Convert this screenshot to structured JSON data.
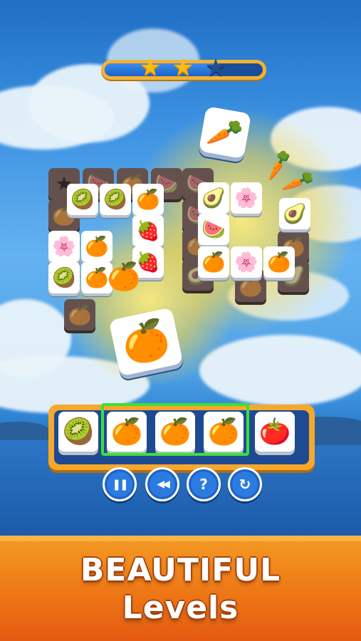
{
  "progress": {
    "fraction": 0.72,
    "stars": [
      {
        "icon": "star-icon",
        "state": "earned",
        "glyph": "★"
      },
      {
        "icon": "star-icon",
        "state": "earned",
        "glyph": "★"
      },
      {
        "icon": "star-icon",
        "state": "unearned",
        "glyph": "★"
      }
    ]
  },
  "board": {
    "flying_tile": {
      "icon": "carrot-icon",
      "glyph": "🥕"
    },
    "selected_tile": {
      "icon": "orange-slice-icon",
      "glyph": "🍊"
    },
    "left_cluster": [
      {
        "icon": "passion-fruit-icon",
        "glyph": "🥝"
      },
      {
        "icon": "passion-fruit-icon",
        "glyph": "🥝"
      },
      {
        "icon": "orange-slice-icon",
        "glyph": "🍊"
      },
      {
        "icon": "strawberry-icon",
        "glyph": "🍓"
      },
      {
        "icon": "cherry-blossom-icon",
        "glyph": "🌸"
      },
      {
        "icon": "orange-slice-icon",
        "glyph": "🍊"
      },
      {
        "icon": "strawberry-icon",
        "glyph": "🍓"
      },
      {
        "icon": "passion-fruit-icon",
        "glyph": "🥝"
      },
      {
        "icon": "orange-slice-icon",
        "glyph": "🍊"
      }
    ],
    "right_cluster": [
      {
        "icon": "avocado-icon",
        "glyph": "🥑"
      },
      {
        "icon": "cherry-blossom-icon",
        "glyph": "🌸"
      },
      {
        "icon": "watermelon-icon",
        "glyph": "🍉"
      },
      {
        "icon": "avocado-icon",
        "glyph": "🥑"
      },
      {
        "icon": "orange-slice-icon",
        "glyph": "🍊"
      },
      {
        "icon": "cherry-blossom-icon",
        "glyph": "🌸"
      },
      {
        "icon": "orange-slice-icon",
        "glyph": "🍊"
      }
    ],
    "floating_carrots": [
      {
        "icon": "carrot-icon",
        "glyph": "🥕"
      },
      {
        "icon": "carrot-icon",
        "glyph": "🥕"
      }
    ]
  },
  "tray": {
    "slots": [
      {
        "icon": "kiwi-icon",
        "glyph": "🥝"
      },
      {
        "icon": "orange-slice-icon",
        "glyph": "🍊"
      },
      {
        "icon": "orange-slice-icon",
        "glyph": "🍊"
      },
      {
        "icon": "orange-slice-icon",
        "glyph": "🍊"
      },
      {
        "icon": "tomato-icon",
        "glyph": "🍅"
      }
    ],
    "matched_count": 3
  },
  "controls": [
    {
      "name": "pause-button",
      "icon": "pause-icon",
      "glyph": "❚❚"
    },
    {
      "name": "undo-button",
      "icon": "rewind-icon",
      "glyph": "◀◀"
    },
    {
      "name": "hint-button",
      "icon": "question-icon",
      "glyph": "?"
    },
    {
      "name": "shuffle-button",
      "icon": "refresh-icon",
      "glyph": "↻"
    }
  ],
  "banner": {
    "line1": "BEAUTIFUL",
    "line2": "Levels"
  },
  "colors": {
    "banner": "#ee7616",
    "match_highlight": "#3ce03a",
    "tray_frame": "#f6a82d",
    "star_gold": "#ffb90f"
  }
}
